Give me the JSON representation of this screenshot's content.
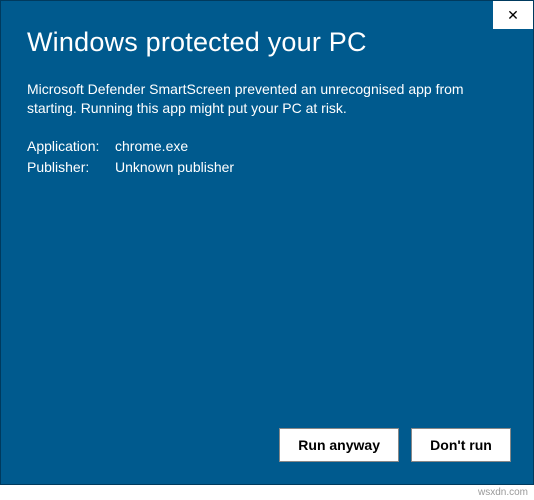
{
  "dialog": {
    "title": "Windows protected your PC",
    "description": "Microsoft Defender SmartScreen prevented an unrecognised app from starting. Running this app might put your PC at risk.",
    "info": {
      "application_label": "Application:",
      "application_value": "chrome.exe",
      "publisher_label": "Publisher:",
      "publisher_value": "Unknown publisher"
    },
    "buttons": {
      "run_anyway": "Run anyway",
      "dont_run": "Don't run"
    },
    "close_glyph": "✕"
  },
  "watermark": "wsxdn.com",
  "colors": {
    "background": "#005a8e",
    "text": "#ffffff",
    "button_bg": "#ffffff",
    "button_text": "#000000"
  }
}
